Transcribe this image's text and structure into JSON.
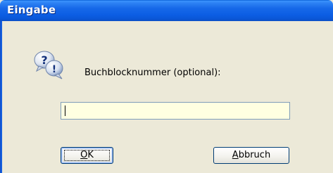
{
  "window": {
    "title": "Eingabe",
    "accent": "#0a57d8",
    "background": "#ece9d8"
  },
  "icon": {
    "name": "question-exclamation-icon"
  },
  "prompt": {
    "label": "Buchblocknummer (optional):"
  },
  "input": {
    "value": "",
    "background": "#ffffe1"
  },
  "buttons": {
    "ok": {
      "mnemonic": "O",
      "rest": "K"
    },
    "cancel": {
      "mnemonic": "A",
      "rest": "bbruch"
    }
  }
}
